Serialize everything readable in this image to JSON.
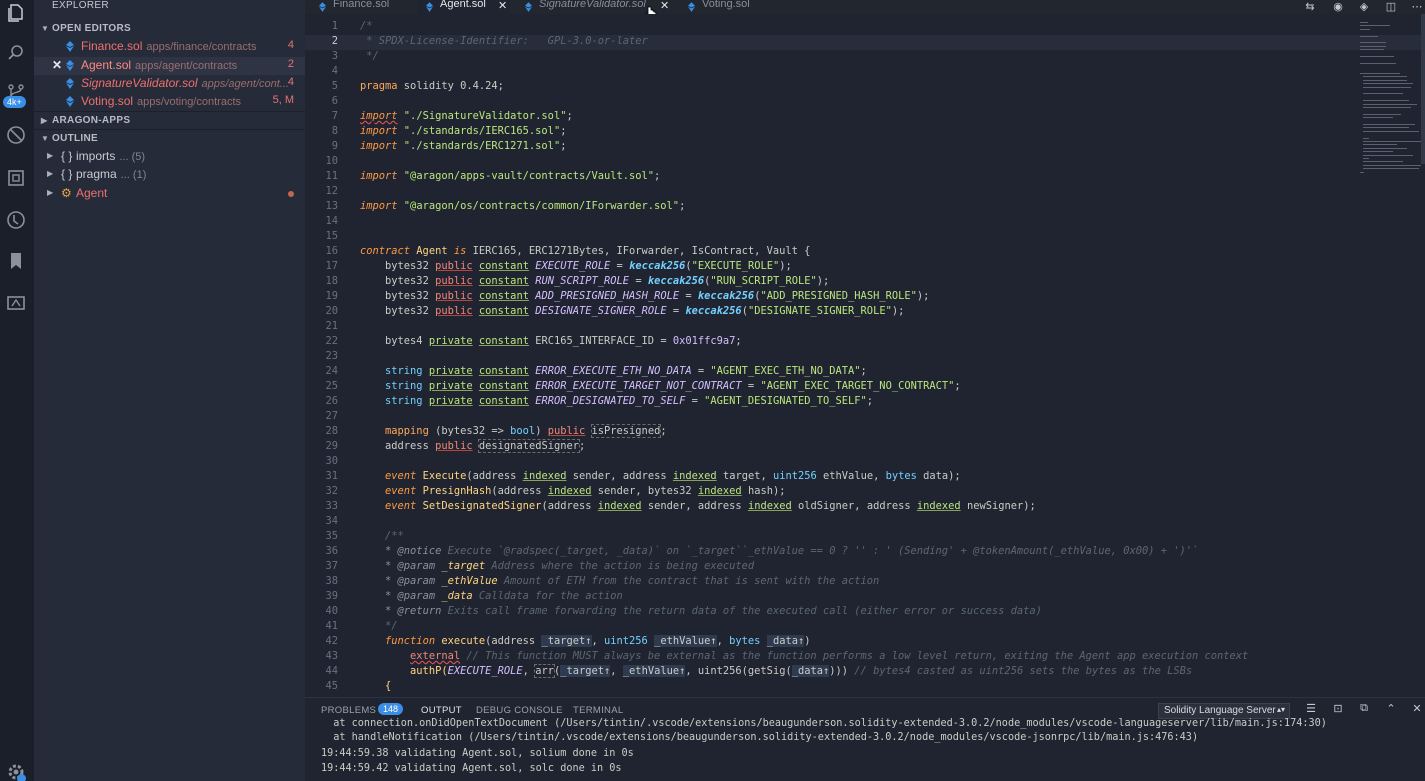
{
  "sidebar": {
    "title": "EXPLORER",
    "open_editors_label": "OPEN EDITORS",
    "open_editors": [
      {
        "name": "Finance.sol",
        "path": "apps/finance/contracts",
        "count": "4"
      },
      {
        "name": "Agent.sol",
        "path": "apps/agent/contracts",
        "count": "2"
      },
      {
        "name": "SignatureValidator.sol",
        "path": "apps/agent/cont...",
        "count": "4"
      },
      {
        "name": "Voting.sol",
        "path": "apps/voting/contracts",
        "count": "5, M"
      }
    ],
    "aragon_apps_label": "ARAGON-APPS",
    "outline_label": "OUTLINE",
    "outline": [
      {
        "symbol": "{ }",
        "label": "imports",
        "meta": "... (5)"
      },
      {
        "symbol": "{ }",
        "label": "pragma",
        "meta": "... (1)"
      },
      {
        "symbol": "⚙",
        "label": "Agent",
        "meta": ""
      }
    ],
    "activity_badge": "4k+"
  },
  "tabs": [
    {
      "name": "Finance.sol",
      "close": ""
    },
    {
      "name": "Agent.sol",
      "close": "✕"
    },
    {
      "name": "SignatureValidator.sol",
      "close": "✕"
    },
    {
      "name": "Voting.sol",
      "close": ""
    }
  ],
  "editor": {
    "lines": [
      {
        "n": "1",
        "t": ""
      },
      {
        "n": "2",
        "t": ""
      },
      {
        "n": "3",
        "t": ""
      },
      {
        "n": "4",
        "t": ""
      },
      {
        "n": "5",
        "t": ""
      },
      {
        "n": "6",
        "t": ""
      },
      {
        "n": "7",
        "t": ""
      },
      {
        "n": "8",
        "t": ""
      },
      {
        "n": "9",
        "t": ""
      },
      {
        "n": "10",
        "t": ""
      },
      {
        "n": "11",
        "t": ""
      },
      {
        "n": "12",
        "t": ""
      },
      {
        "n": "13",
        "t": ""
      },
      {
        "n": "14",
        "t": ""
      },
      {
        "n": "15",
        "t": ""
      },
      {
        "n": "16",
        "t": ""
      },
      {
        "n": "17",
        "t": ""
      },
      {
        "n": "18",
        "t": ""
      },
      {
        "n": "19",
        "t": ""
      },
      {
        "n": "20",
        "t": ""
      },
      {
        "n": "21",
        "t": ""
      },
      {
        "n": "22",
        "t": ""
      },
      {
        "n": "23",
        "t": ""
      },
      {
        "n": "24",
        "t": ""
      },
      {
        "n": "25",
        "t": ""
      },
      {
        "n": "26",
        "t": ""
      },
      {
        "n": "27",
        "t": ""
      },
      {
        "n": "28",
        "t": ""
      },
      {
        "n": "29",
        "t": ""
      },
      {
        "n": "30",
        "t": ""
      },
      {
        "n": "31",
        "t": ""
      },
      {
        "n": "32",
        "t": ""
      },
      {
        "n": "33",
        "t": ""
      },
      {
        "n": "34",
        "t": ""
      },
      {
        "n": "35",
        "t": ""
      },
      {
        "n": "36",
        "t": ""
      },
      {
        "n": "37",
        "t": ""
      },
      {
        "n": "38",
        "t": ""
      },
      {
        "n": "39",
        "t": ""
      },
      {
        "n": "40",
        "t": ""
      },
      {
        "n": "41",
        "t": ""
      },
      {
        "n": "42",
        "t": ""
      },
      {
        "n": "43",
        "t": ""
      },
      {
        "n": "44",
        "t": ""
      },
      {
        "n": "45",
        "t": ""
      }
    ],
    "code": {
      "l1": "/*",
      "l2a": " * ",
      "l2b": "SPDX-License-Identifier:   GPL-3.0-or-later",
      "l3": " */",
      "l5a": "pragma",
      "l5b": " solidity ",
      "l5c": "0.4.24",
      "l5d": ";",
      "l7a": "import",
      "l7b": " \"./SignatureValidator.sol\"",
      "l8a": "import",
      "l8b": " \"./standards/IERC165.sol\"",
      "l9a": "import",
      "l9b": " \"./standards/ERC1271.sol\"",
      "l11a": "import",
      "l11b": " \"@aragon/apps-vault/contracts/Vault.sol\"",
      "l13a": "import",
      "l13b": " \"@aragon/os/contracts/common/IForwarder.sol\"",
      "semi": ";",
      "l16a": "contract",
      "l16b": " Agent ",
      "l16c": "is",
      "l16d": " IERC165, ERC1271Bytes, IForwarder, IsContract, Vault {",
      "bytes32": "bytes32",
      "public": "public",
      "constant": "constant",
      "private": "private",
      "keccak": "keccak256",
      "l17n": "EXECUTE_ROLE",
      "l17s": "\"EXECUTE_ROLE\"",
      "l18n": "RUN_SCRIPT_ROLE",
      "l18s": "\"RUN_SCRIPT_ROLE\"",
      "l19n": "ADD_PRESIGNED_HASH_ROLE",
      "l19s": "\"ADD_PRESIGNED_HASH_ROLE\"",
      "l20n": "DESIGNATE_SIGNER_ROLE",
      "l20s": "\"DESIGNATE_SIGNER_ROLE\"",
      "l22a": "bytes4",
      "l22b": " ERC165_INTERFACE_ID = ",
      "l22c": "0x01ffc9a7",
      "string": "string",
      "l24n": "ERROR_EXECUTE_ETH_NO_DATA",
      "l24s": "\"AGENT_EXEC_ETH_NO_DATA\"",
      "l25n": "ERROR_EXECUTE_TARGET_NOT_CONTRACT",
      "l25s": "\"AGENT_EXEC_TARGET_NO_CONTRACT\"",
      "l26n": "ERROR_DESIGNATED_TO_SELF",
      "l26s": "\"AGENT_DESIGNATED_TO_SELF\"",
      "l28a": "mapping",
      "l28b": " (bytes32 => ",
      "l28c": "bool",
      "l28d": ") ",
      "l28e": "isPresigned",
      "l29a": "address",
      "l29e": "designatedSigner",
      "event": "event",
      "indexed": "indexed",
      "address": "address",
      "l31a": "Execute",
      "l31b": "sender, ",
      "l31c": "target, ",
      "l31d": "uint256",
      "l31e": " ethValue, ",
      "l31f": "bytes",
      "l31g": " data);",
      "l32a": "PresignHash",
      "l32b": "sender, bytes32 ",
      "l32c": "hash);",
      "l33a": "SetDesignatedSigner",
      "l33b": "sender, ",
      "l33c": "oldSigner, ",
      "l33d": "newSigner);",
      "l35": "/**",
      "l36a": "* @notice",
      "l36b": " Execute `@radspec(_target, _data)` on `_target``_ethValue == 0 ? '' : ' (Sending' + @tokenAmount(_ethValue, 0x00) + ')'`",
      "l37a": "* @param",
      "l37b": " _target",
      "l37c": " Address where the action is being executed",
      "l38a": "* @param",
      "l38b": " _ethValue",
      "l38c": " Amount of ETH from the contract that is sent with the action",
      "l39a": "* @param",
      "l39b": " _data",
      "l39c": " Calldata for the action",
      "l40a": "* @return",
      "l40b": " Exits call frame forwarding the return data of the executed call (either error or success data)",
      "l41": "*/",
      "l42a": "function",
      "l42b": " execute",
      "l42c": "_target↑",
      "l42d": "uint256",
      "l42e": "_ethValue↑",
      "l42f": "bytes",
      "l42g": "_data↑",
      "l43a": "external",
      "l43b": " // This function MUST always be external as the function performs a low level return, exiting the Agent app execution context",
      "l44a": "authP(",
      "l44b": "EXECUTE_ROLE",
      "l44c": "arr",
      "l44d": "_target↑",
      "l44e": ", ",
      "l44f": "_ethValue↑",
      "l44g": ", uint256(getSig(",
      "l44h": "_data↑",
      "l44i": "))) ",
      "l44j": "// bytes4 casted as uint256 sets the bytes as the LSBs",
      "l45": "{"
    }
  },
  "panel": {
    "tabs": [
      "PROBLEMS",
      "OUTPUT",
      "DEBUG CONSOLE",
      "TERMINAL"
    ],
    "problems_count": "148",
    "select_value": "Solidity Language Server",
    "output_lines": [
      "  at connection.onDidOpenTextDocument (/Users/tintin/.vscode/extensions/beaugunderson.solidity-extended-3.0.2/node_modules/vscode-languageserver/lib/main.js:174:30)",
      "  at handleNotification (/Users/tintin/.vscode/extensions/beaugunderson.solidity-extended-3.0.2/node_modules/vscode-jsonrpc/lib/main.js:476:43)",
      "19:44:59.38 validating Agent.sol, solium done in 0s",
      "19:44:59.42 validating Agent.sol, solc done in 0s"
    ]
  },
  "colors": {
    "accent": "#3a8ee6",
    "error": "#e57373",
    "keyword": "#ff9944",
    "string": "#bae67e",
    "type": "#73d0ff"
  }
}
